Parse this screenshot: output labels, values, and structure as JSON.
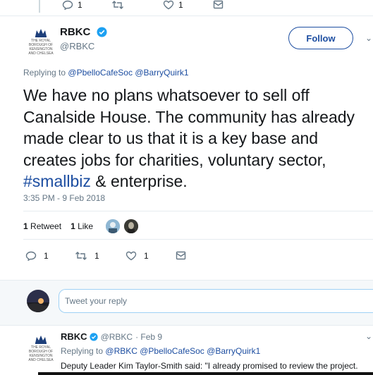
{
  "top_actions": {
    "reply_count": "1",
    "like_count": "1"
  },
  "tweet": {
    "name": "RBKC",
    "handle": "@RBKC",
    "logo_text": "THE ROYAL BOROUGH OF KENSINGTON AND CHELSEA",
    "follow_label": "Follow",
    "replying_to_prefix": "Replying to",
    "replying_to_1": "@PbelloCafeSoc",
    "replying_to_2": "@BarryQuirk1",
    "text_line1": "We have no plans whatsoever to sell off",
    "text_line2": "Canalside House. The community has already",
    "text_line3": "made clear to us that it is a key base and",
    "text_line4": "creates jobs for charities, voluntary sector,",
    "hashtag": "#smallbiz",
    "text_line5_rest": " & enterprise.",
    "timestamp": "3:35 PM - 9 Feb 2018",
    "retweets_count": "1",
    "retweets_label": "Retweet",
    "likes_count": "1",
    "likes_label": "Like",
    "reply_count": "1",
    "retweet_count": "1",
    "like_count": "1"
  },
  "reply_box": {
    "placeholder": "Tweet your reply"
  },
  "second_tweet": {
    "name": "RBKC",
    "handle": "@RBKC",
    "date": "· Feb 9",
    "replying_to_prefix": "Replying to",
    "mentions": "@RBKC @PbelloCafeSoc @BarryQuirk1",
    "text": "Deputy Leader Kim Taylor-Smith said: \"I already promised to review the project."
  },
  "colors": {
    "accent": "#1d4ea1",
    "verified": "#1da1f2",
    "secondary_text": "#657786"
  }
}
